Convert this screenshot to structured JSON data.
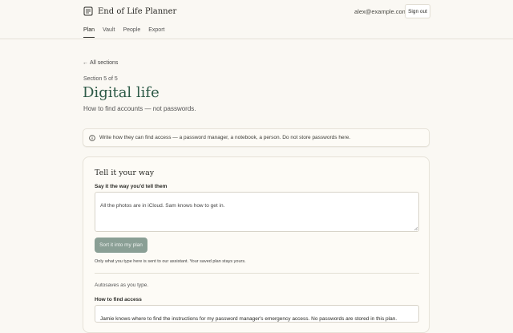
{
  "header": {
    "app_title": "End of Life Planner",
    "user_email": "alex@example.com",
    "signout_label": "Sign out",
    "logo_icon": "planner-book-icon"
  },
  "nav": {
    "tabs": [
      {
        "label": "Plan",
        "active": true
      },
      {
        "label": "Vault",
        "active": false
      },
      {
        "label": "People",
        "active": false
      },
      {
        "label": "Export",
        "active": false
      }
    ]
  },
  "content": {
    "back_arrow": "←",
    "back_label": "All sections",
    "section_count": "Section 5 of 5",
    "title": "Digital life",
    "subtitle": "How to find accounts — not passwords.",
    "notice": "Write how they can find access — a password manager, a notebook, a person. Do not store passwords here.",
    "notice_icon": "info-icon"
  },
  "card": {
    "title": "Tell it your way",
    "say_label": "Say it the way you'd tell them",
    "say_value": "All the photos are in iCloud. Sam knows how to get in.",
    "sort_button": "Sort it into my plan",
    "helper_text": "Only what you type here is sent to our assistant. Your saved plan stays yours.",
    "autosave_text": "Autosaves as you type.",
    "access_label": "How to find access",
    "access_value": "Jamie knows where to find the instructions for my password manager's emergency access. No passwords are stored in this plan."
  },
  "colors": {
    "accent": "#2d5a47",
    "button_disabled": "#8a9f95",
    "background": "#faf8f3"
  }
}
